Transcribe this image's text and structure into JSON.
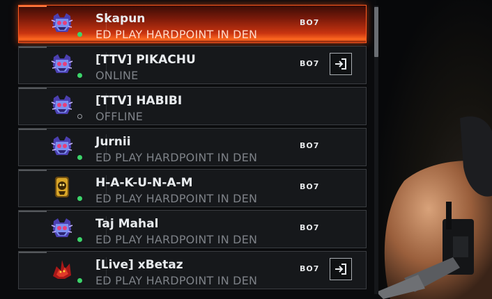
{
  "friends": [
    {
      "name": "Skapun",
      "activity": "ED PLAY HARDPOINT IN DEN",
      "game": "BO7",
      "status": "online",
      "emblem": "purple-cat-emblem-icon",
      "selected": true,
      "joinable": false
    },
    {
      "name": "[TTV] PIKACHU",
      "activity": "ONLINE",
      "game": "BO7",
      "status": "online",
      "emblem": "purple-cat-emblem-icon",
      "selected": false,
      "joinable": true
    },
    {
      "name": "[TTV] HABIBI",
      "activity": "OFFLINE",
      "game": "",
      "status": "offline",
      "emblem": "purple-cat-emblem-icon",
      "selected": false,
      "joinable": false
    },
    {
      "name": "Jurnii",
      "activity": "ED PLAY HARDPOINT IN DEN",
      "game": "BO7",
      "status": "online",
      "emblem": "purple-cat-emblem-icon",
      "selected": false,
      "joinable": false
    },
    {
      "name": "H-A-K-U-N-A-M",
      "activity": "ED PLAY HARDPOINT IN DEN",
      "game": "BO7",
      "status": "online",
      "emblem": "gold-emblem-icon",
      "selected": false,
      "joinable": false
    },
    {
      "name": "Taj Mahal",
      "activity": "ED PLAY HARDPOINT IN DEN",
      "game": "BO7",
      "status": "online",
      "emblem": "purple-cat-emblem-icon",
      "selected": false,
      "joinable": false
    },
    {
      "name": "[Live] xBetaz",
      "activity": "ED PLAY HARDPOINT IN DEN",
      "game": "BO7",
      "status": "online",
      "emblem": "red-dragon-emblem-icon",
      "selected": false,
      "joinable": true
    }
  ],
  "colors": {
    "accent": "#ff5a20",
    "online": "#3cd46a",
    "row_bg": "#16181b"
  },
  "icons": {
    "join": "join-party-icon"
  }
}
